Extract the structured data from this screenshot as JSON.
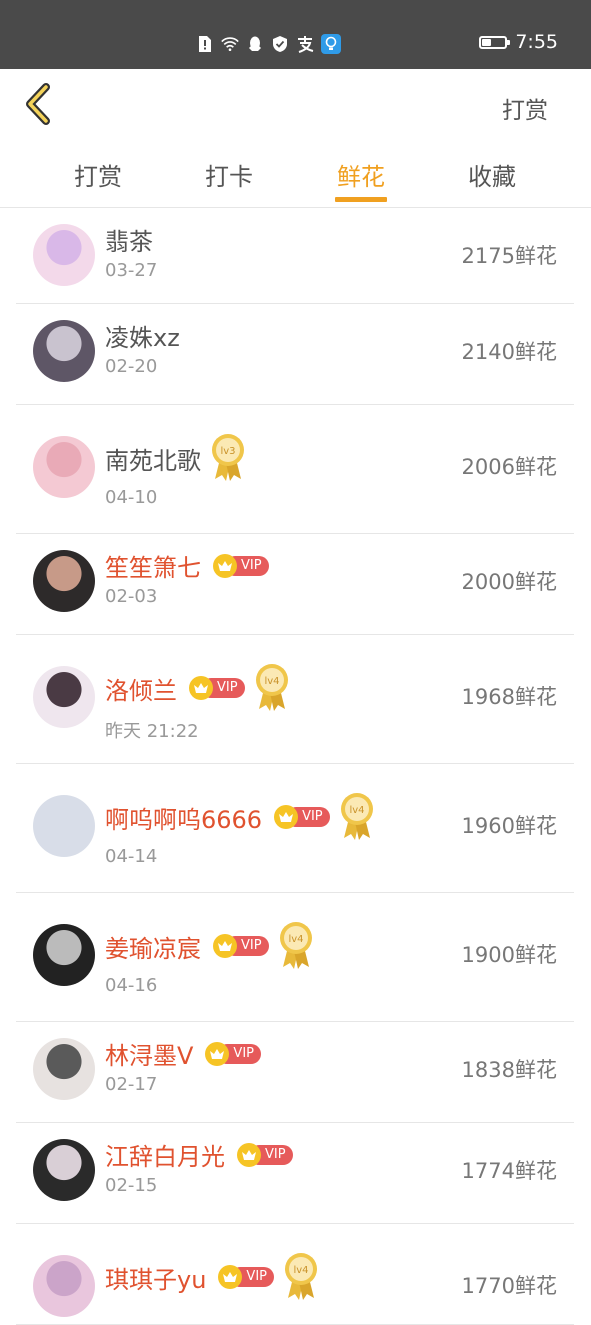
{
  "status_bar": {
    "time": "7:55",
    "icons": [
      "sim-alert-icon",
      "wifi-icon",
      "qq-icon",
      "shield-icon",
      "alipay-icon",
      "bulb-icon"
    ],
    "battery_level": 0.35
  },
  "header": {
    "back_icon": "chevron-left-icon",
    "action_label": "打赏",
    "accent_color": "#f0a020"
  },
  "tabs": [
    {
      "label": "打赏",
      "active": false
    },
    {
      "label": "打卡",
      "active": false
    },
    {
      "label": "鲜花",
      "active": true
    },
    {
      "label": "收藏",
      "active": false
    }
  ],
  "vip_label": "VIP",
  "items": [
    {
      "name": "翡茶",
      "date": "03-27",
      "amount": "2175鲜花",
      "vip": false,
      "level": ""
    },
    {
      "name": "凌姝xz",
      "date": "02-20",
      "amount": "2140鲜花",
      "vip": false,
      "level": ""
    },
    {
      "name": "南苑北歌",
      "date": "04-10",
      "amount": "2006鲜花",
      "vip": false,
      "level": "lv3"
    },
    {
      "name": "笙笙箫七",
      "date": "02-03",
      "amount": "2000鲜花",
      "vip": true,
      "level": ""
    },
    {
      "name": "洛倾兰",
      "date": "昨天 21:22",
      "amount": "1968鲜花",
      "vip": true,
      "level": "lv4"
    },
    {
      "name": "啊呜啊呜6666",
      "date": "04-14",
      "amount": "1960鲜花",
      "vip": true,
      "level": "lv4"
    },
    {
      "name": "姜瑜凉宸",
      "date": "04-16",
      "amount": "1900鲜花",
      "vip": true,
      "level": "lv4"
    },
    {
      "name": "林浔墨V",
      "date": "02-17",
      "amount": "1838鲜花",
      "vip": true,
      "level": ""
    },
    {
      "name": "江辞白月光",
      "date": "02-15",
      "amount": "1774鲜花",
      "vip": true,
      "level": ""
    },
    {
      "name": "琪琪子yu",
      "date": "",
      "amount": "1770鲜花",
      "vip": true,
      "level": "lv4"
    }
  ]
}
